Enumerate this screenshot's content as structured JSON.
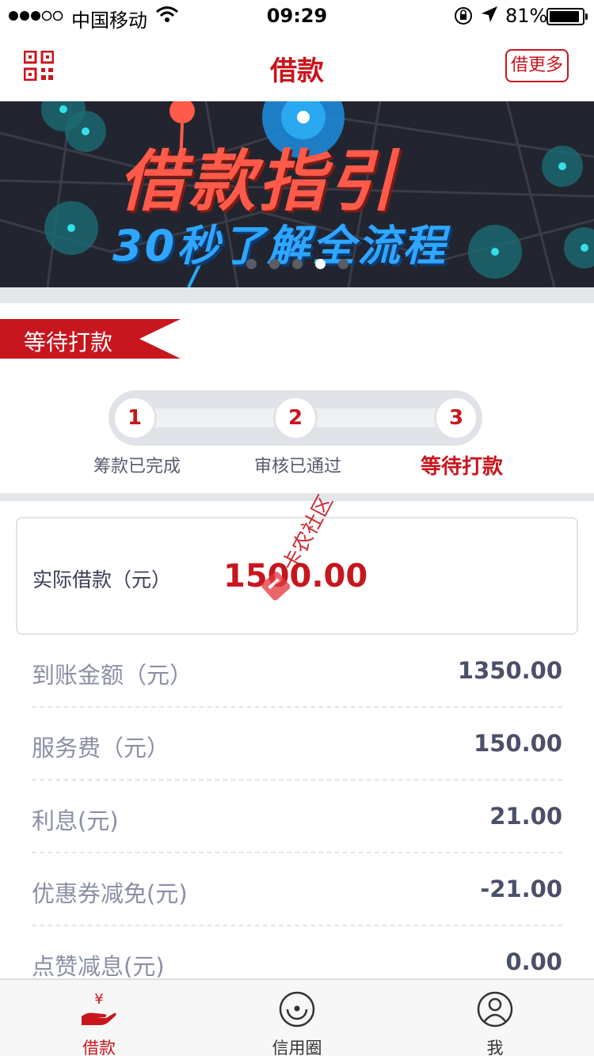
{
  "status_bar": {
    "carrier": "中国移动",
    "time": "09:29",
    "battery": "81%"
  },
  "nav": {
    "title": "借款",
    "more_button": "借更多"
  },
  "banner": {
    "headline": "借款指引",
    "subline": "30秒了解全流程",
    "slide_count": 5,
    "active_slide_index": 3
  },
  "status_flag": "等待打款",
  "steps": [
    {
      "number": "1",
      "label": "筹款已完成",
      "active": false
    },
    {
      "number": "2",
      "label": "审核已通过",
      "active": false
    },
    {
      "number": "3",
      "label": "等待打款",
      "active": true
    }
  ],
  "main_amount": {
    "label": "实际借款（元）",
    "value": "1500.00"
  },
  "details": [
    {
      "label": "到账金额（元）",
      "value": "1350.00"
    },
    {
      "label": "服务费（元）",
      "value": "150.00"
    },
    {
      "label": "利息(元)",
      "value": "21.00"
    },
    {
      "label": "优惠券减免(元)",
      "value": "-21.00"
    },
    {
      "label": "点赞减息(元)",
      "value": "0.00"
    }
  ],
  "watermark": "卡农社区",
  "tabs": [
    {
      "label": "借款",
      "icon": "loan-hand-icon",
      "active": true
    },
    {
      "label": "信用圈",
      "icon": "credit-circle-icon",
      "active": false
    },
    {
      "label": "我",
      "icon": "user-icon",
      "active": false
    }
  ],
  "colors": {
    "brand_red": "#c8161e",
    "divider_gray": "#e4e7ea"
  }
}
